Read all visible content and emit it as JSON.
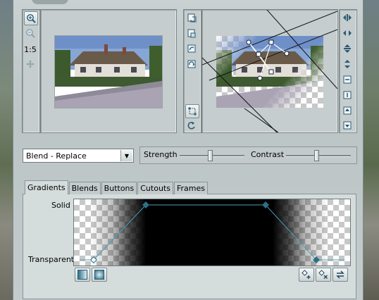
{
  "toolbar_left": {
    "zoom_in_icon": "zoom-in-icon",
    "zoom_out_icon": "zoom-out-icon",
    "zoom_ratio": "1:5",
    "pan_icon": "move-icon"
  },
  "blend": {
    "mode_selected": "Blend - Replace",
    "strength_label": "Strength",
    "contrast_label": "Contrast",
    "strength_value": 0.47,
    "contrast_value": 0.47
  },
  "tabs": [
    {
      "label": "Gradients",
      "active": true
    },
    {
      "label": "Blends",
      "active": false
    },
    {
      "label": "Buttons",
      "active": false
    },
    {
      "label": "Cutouts",
      "active": false
    },
    {
      "label": "Frames",
      "active": false
    }
  ],
  "gradient_editor": {
    "top_label": "Solid",
    "bottom_label": "Transparent"
  },
  "colors": {
    "panel": "#c3cbcc",
    "curve": "#4a9fb6",
    "handle": "#2d6f86"
  }
}
